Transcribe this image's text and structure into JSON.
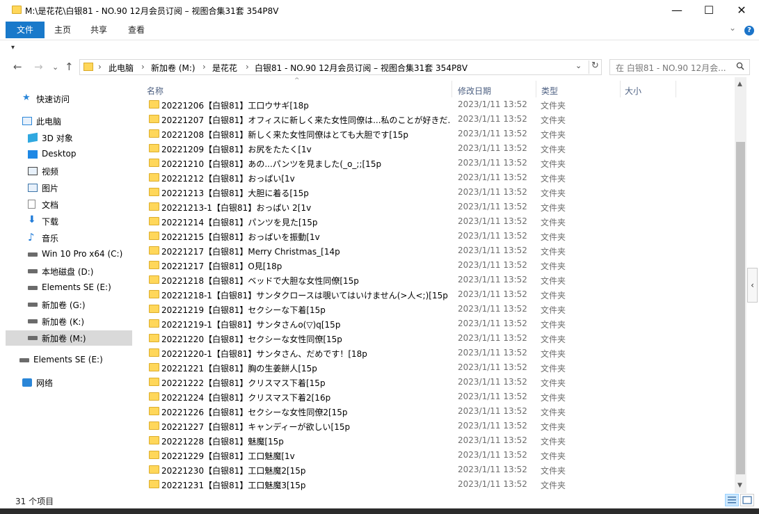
{
  "window": {
    "title": "M:\\是花花\\白银81 - NO.90 12月会员订阅 – 视图合集31套 354P8V",
    "minimize": "—",
    "maximize": "☐",
    "close": "✕"
  },
  "ribbon": {
    "tabs": [
      "文件",
      "主页",
      "共享",
      "查看"
    ],
    "collapse": "⌄",
    "help": "?"
  },
  "qat": {
    "customize": "▾"
  },
  "nav": {
    "back": "←",
    "forward": "→",
    "recent": "⌄",
    "up": "↑",
    "breadcrumb": [
      "此电脑",
      "新加卷 (M:)",
      "是花花",
      "白银81 - NO.90 12月会员订阅 – 视图合集31套 354P8V"
    ],
    "separator": "›",
    "dropdown": "⌄",
    "refresh": "↻"
  },
  "search": {
    "placeholder": "在 白银81 - NO.90 12月会..."
  },
  "sidebar": {
    "items": [
      {
        "label": "快速访问",
        "icon": "star-icon",
        "color": "#2a86d8"
      },
      {
        "label": "此电脑",
        "icon": "computer-icon",
        "color": "#2a86d8"
      },
      {
        "label": "3D 对象",
        "icon": "cube-icon",
        "color": "#30a8e0"
      },
      {
        "label": "Desktop",
        "icon": "desktop-icon",
        "color": "#1e88e5"
      },
      {
        "label": "视频",
        "icon": "film-icon",
        "color": "#444"
      },
      {
        "label": "图片",
        "icon": "picture-icon",
        "color": "#3c74a8"
      },
      {
        "label": "文档",
        "icon": "document-icon",
        "color": "#666"
      },
      {
        "label": "下载",
        "icon": "download-icon",
        "color": "#1e7ad8"
      },
      {
        "label": "音乐",
        "icon": "music-icon",
        "color": "#1e7ad8"
      },
      {
        "label": "Win 10 Pro x64 (C:)",
        "icon": "drive-icon",
        "color": "#555"
      },
      {
        "label": "本地磁盘 (D:)",
        "icon": "drive-icon",
        "color": "#555"
      },
      {
        "label": "Elements SE (E:)",
        "icon": "drive-icon",
        "color": "#555"
      },
      {
        "label": "新加卷 (G:)",
        "icon": "drive-icon",
        "color": "#555"
      },
      {
        "label": "新加卷 (K:)",
        "icon": "drive-icon",
        "color": "#555"
      },
      {
        "label": "新加卷 (M:)",
        "icon": "drive-icon",
        "color": "#555"
      },
      {
        "label": "Elements SE (E:)",
        "icon": "drive-icon",
        "color": "#555"
      },
      {
        "label": "网络",
        "icon": "network-icon",
        "color": "#2a86d8"
      }
    ],
    "selected_index": 14
  },
  "columns": {
    "name": "名称",
    "date": "修改日期",
    "type": "类型",
    "size": "大小",
    "sort_indicator": "^"
  },
  "files": [
    {
      "name": "20221206【白银81】工口ウサギ[18p",
      "date": "2023/1/11 13:52",
      "type": "文件夹"
    },
    {
      "name": "20221207【白银81】オフィスに新しく来た女性同僚は...私のことが好きだ...",
      "date": "2023/1/11 13:52",
      "type": "文件夹"
    },
    {
      "name": "20221208【白银81】新しく来た女性同僚はとても大胆です[15p",
      "date": "2023/1/11 13:52",
      "type": "文件夹"
    },
    {
      "name": "20221209【白银81】お尻をたたく[1v",
      "date": "2023/1/11 13:52",
      "type": "文件夹"
    },
    {
      "name": "20221210【白银81】あの...パンツを見ました(_o_;;[15p",
      "date": "2023/1/11 13:52",
      "type": "文件夹"
    },
    {
      "name": "20221212【白银81】おっぱい[1v",
      "date": "2023/1/11 13:52",
      "type": "文件夹"
    },
    {
      "name": "20221213【白银81】大胆に着る[15p",
      "date": "2023/1/11 13:52",
      "type": "文件夹"
    },
    {
      "name": "20221213-1【白银81】おっぱい 2[1v",
      "date": "2023/1/11 13:52",
      "type": "文件夹"
    },
    {
      "name": "20221214【白银81】パンツを見た[15p",
      "date": "2023/1/11 13:52",
      "type": "文件夹"
    },
    {
      "name": "20221215【白银81】おっぱいを振動[1v",
      "date": "2023/1/11 13:52",
      "type": "文件夹"
    },
    {
      "name": "20221217【白银81】Merry Christmas_[14p",
      "date": "2023/1/11 13:52",
      "type": "文件夹"
    },
    {
      "name": "20221217【白银81】O見[18p",
      "date": "2023/1/11 13:52",
      "type": "文件夹"
    },
    {
      "name": "20221218【白银81】ベッドで大胆な女性同僚[15p",
      "date": "2023/1/11 13:52",
      "type": "文件夹"
    },
    {
      "name": "20221218-1【白银81】サンタクロースは覗いてはいけません(>人<;)[15p",
      "date": "2023/1/11 13:52",
      "type": "文件夹"
    },
    {
      "name": "20221219【白银81】セクシーな下着[15p",
      "date": "2023/1/11 13:52",
      "type": "文件夹"
    },
    {
      "name": "20221219-1【白银81】サンタさんo(▽)q[15p",
      "date": "2023/1/11 13:52",
      "type": "文件夹"
    },
    {
      "name": "20221220【白银81】セクシーな女性同僚[15p",
      "date": "2023/1/11 13:52",
      "type": "文件夹"
    },
    {
      "name": "20221220-1【白银81】サンタさん、だめです！[18p",
      "date": "2023/1/11 13:52",
      "type": "文件夹"
    },
    {
      "name": "20221221【白银81】胸の生姜餅人[15p",
      "date": "2023/1/11 13:52",
      "type": "文件夹"
    },
    {
      "name": "20221222【白银81】クリスマス下着[15p",
      "date": "2023/1/11 13:52",
      "type": "文件夹"
    },
    {
      "name": "20221224【白银81】クリスマス下着2[16p",
      "date": "2023/1/11 13:52",
      "type": "文件夹"
    },
    {
      "name": "20221226【白银81】セクシーな女性同僚2[15p",
      "date": "2023/1/11 13:52",
      "type": "文件夹"
    },
    {
      "name": "20221227【白银81】キャンディーが欲しい[15p",
      "date": "2023/1/11 13:52",
      "type": "文件夹"
    },
    {
      "name": "20221228【白银81】魅魔[15p",
      "date": "2023/1/11 13:52",
      "type": "文件夹"
    },
    {
      "name": "20221229【白银81】工口魅魔[1v",
      "date": "2023/1/11 13:52",
      "type": "文件夹"
    },
    {
      "name": "20221230【白银81】工口魅魔2[15p",
      "date": "2023/1/11 13:52",
      "type": "文件夹"
    },
    {
      "name": "20221231【白银81】工口魅魔3[15p",
      "date": "2023/1/11 13:52",
      "type": "文件夹"
    }
  ],
  "scrollbar": {
    "up": "▲",
    "down": "▼"
  },
  "preview_toggle": "‹",
  "status": {
    "item_count": "31 个项目"
  },
  "colors": {
    "accent": "#1979ca",
    "folder": "#ffd75a",
    "header_text": "#4d6082",
    "selected_nav": "#d9d9d9"
  }
}
